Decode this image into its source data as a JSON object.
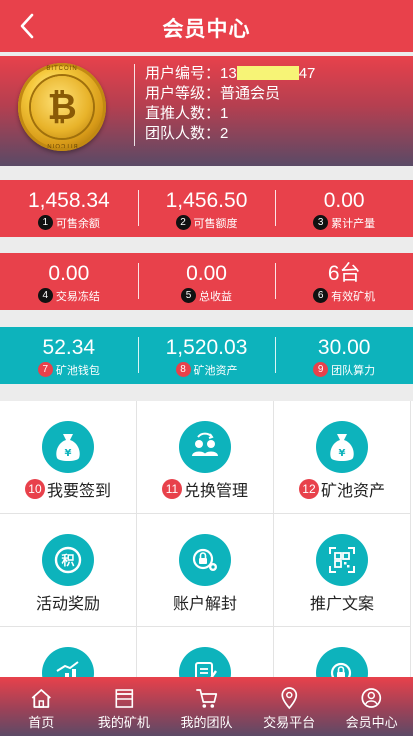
{
  "header": {
    "title": "会员中心",
    "back_icon": "chevron-left-icon"
  },
  "profile": {
    "coin_text_top": "BITCOIN",
    "coin_text_bottom": "BITCOIN",
    "coin_symbol": "₿",
    "user_id_label": "用户编号：",
    "user_id_prefix": "13",
    "user_id_suffix": "47",
    "level": "用户等级：普通会员",
    "direct": "直推人数：1",
    "team": "团队人数：2"
  },
  "stats_row1": [
    {
      "badge": "1",
      "value": "1,458.34",
      "label": "可售余额"
    },
    {
      "badge": "2",
      "value": "1,456.50",
      "label": "可售额度"
    },
    {
      "badge": "3",
      "value": "0.00",
      "label": "累计产量"
    }
  ],
  "stats_row2": [
    {
      "badge": "4",
      "value": "0.00",
      "label": "交易冻结"
    },
    {
      "badge": "5",
      "value": "0.00",
      "label": "总收益"
    },
    {
      "badge": "6",
      "value": "6台",
      "label": "有效矿机"
    }
  ],
  "stats_row3": [
    {
      "badge": "7",
      "value": "52.34",
      "label": "矿池钱包"
    },
    {
      "badge": "8",
      "value": "1,520.03",
      "label": "矿池资产"
    },
    {
      "badge": "9",
      "value": "30.00",
      "label": "团队算力"
    }
  ],
  "menu": [
    {
      "badge": "10",
      "label": "我要签到",
      "icon": "money-bag-icon"
    },
    {
      "badge": "11",
      "label": "兑换管理",
      "icon": "exchange-users-icon"
    },
    {
      "badge": "12",
      "label": "矿池资产",
      "icon": "money-bag-icon"
    },
    {
      "badge": "",
      "label": "活动奖励",
      "icon": "points-coin-icon"
    },
    {
      "badge": "",
      "label": "账户解封",
      "icon": "unlock-settings-icon"
    },
    {
      "badge": "",
      "label": "推广文案",
      "icon": "qrcode-icon"
    },
    {
      "badge": "",
      "label": "",
      "icon": "chart-growth-icon"
    },
    {
      "badge": "",
      "label": "",
      "icon": "edit-document-icon"
    },
    {
      "badge": "",
      "label": "",
      "icon": "lock-settings-icon"
    }
  ],
  "bottom_nav": [
    {
      "label": "首页",
      "icon": "home-icon"
    },
    {
      "label": "我的矿机",
      "icon": "store-icon"
    },
    {
      "label": "我的团队",
      "icon": "cart-icon"
    },
    {
      "label": "交易平台",
      "icon": "location-pin-icon"
    },
    {
      "label": "会员中心",
      "icon": "user-icon"
    }
  ],
  "colors": {
    "primary_red": "#e8414b",
    "teal": "#0db3bc",
    "mask_yellow": "#f7f476"
  }
}
